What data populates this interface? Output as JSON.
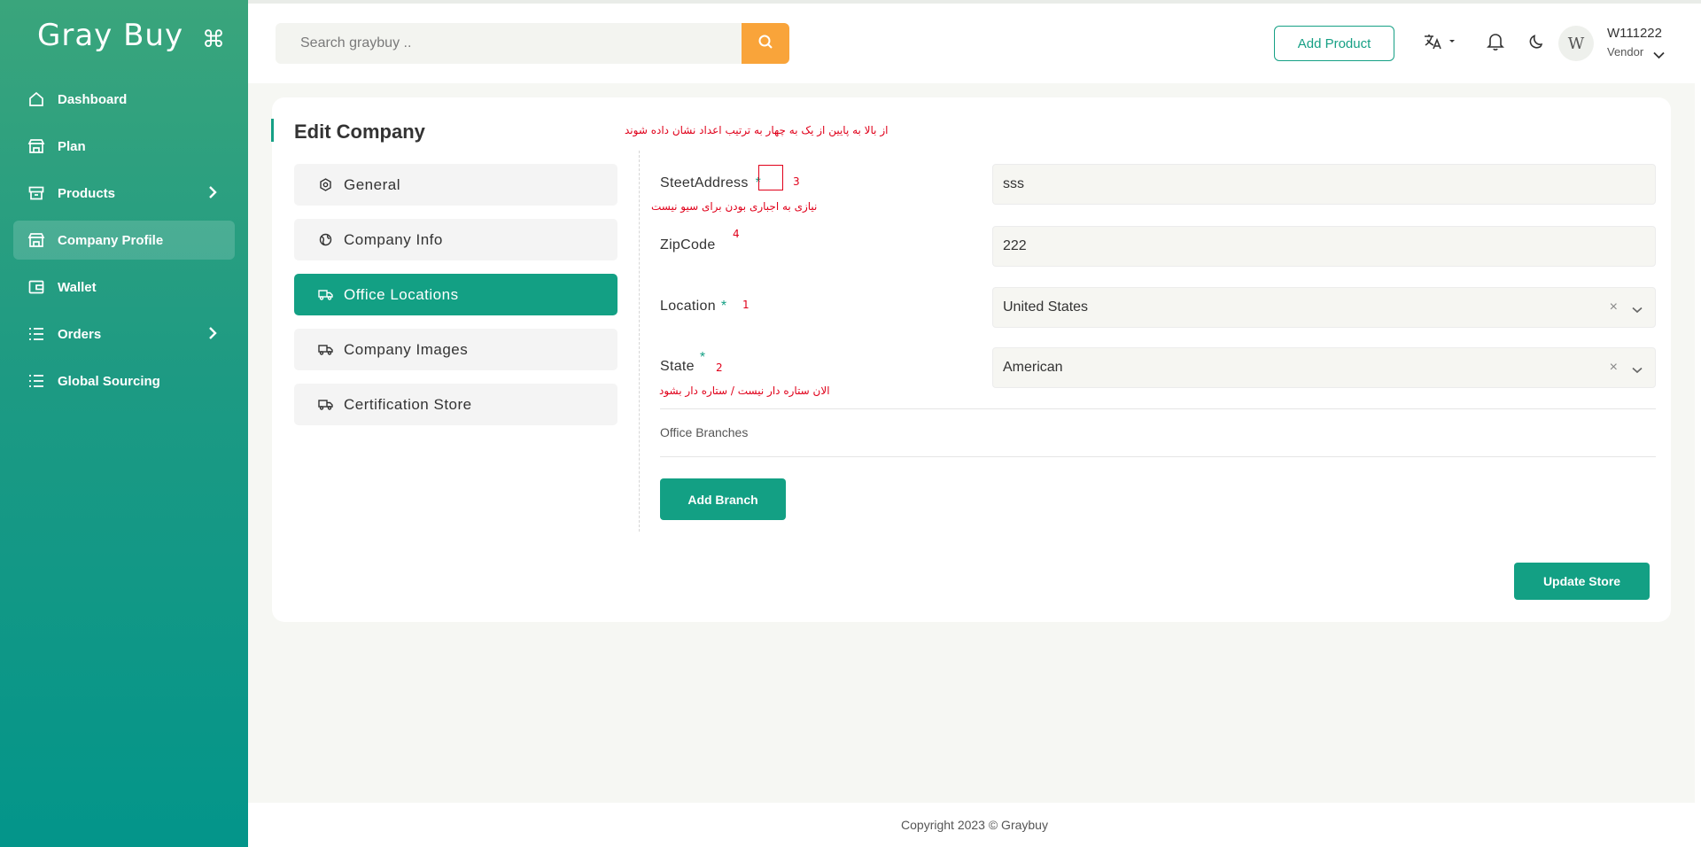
{
  "brand": {
    "name": "Gray Buy",
    "cmd_symbol": "⌘"
  },
  "sidebar": {
    "items": [
      {
        "label": "Dashboard",
        "icon": "home-icon"
      },
      {
        "label": "Plan",
        "icon": "store-icon"
      },
      {
        "label": "Products",
        "icon": "box-icon",
        "has_submenu": true
      },
      {
        "label": "Company Profile",
        "icon": "store-icon",
        "active": true
      },
      {
        "label": "Wallet",
        "icon": "wallet-icon"
      },
      {
        "label": "Orders",
        "icon": "list-icon",
        "has_submenu": true
      },
      {
        "label": "Global Sourcing",
        "icon": "list-icon"
      }
    ]
  },
  "header": {
    "search_placeholder": "Search graybuy ..",
    "add_product_label": "Add Product",
    "avatar_letter": "W",
    "user_name": "W111222",
    "user_role": "Vendor"
  },
  "page": {
    "title": "Edit Company",
    "tabs": [
      {
        "label": "General",
        "icon": "settings-icon"
      },
      {
        "label": "Company Info",
        "icon": "globe-icon"
      },
      {
        "label": "Office Locations",
        "icon": "truck-icon",
        "active": true
      },
      {
        "label": "Company Images",
        "icon": "truck-icon"
      },
      {
        "label": "Certification Store",
        "icon": "truck-icon"
      }
    ],
    "fields": {
      "street": {
        "label": "SteetAddress",
        "required_mark": "*",
        "value": "sss"
      },
      "zip": {
        "label": "ZipCode",
        "value": "222"
      },
      "location": {
        "label": "Location",
        "required_mark": "*",
        "value": "United States",
        "clear": "×"
      },
      "state": {
        "label": "State",
        "required_mark": "*",
        "value": "American",
        "clear": "×"
      }
    },
    "office_branches_label": "Office Branches",
    "add_branch_label": "Add Branch",
    "update_store_label": "Update Store"
  },
  "annotations": {
    "top_note": "از بالا به پایین از یک به چهار به ترتیب اعداد نشان داده شوند",
    "street_note": "نیازی به اجباری بودن برای سیو نیست",
    "state_note": "الان ستاره دار نیست / ستاره دار بشود",
    "num_street": "3",
    "num_zip": "4",
    "num_location": "1",
    "num_state": "2"
  },
  "footer": {
    "copyright": "Copyright 2023 © Graybuy"
  },
  "colors": {
    "accent": "#13a084",
    "search_button": "#f9a43a",
    "annotation": "#e0001a"
  }
}
